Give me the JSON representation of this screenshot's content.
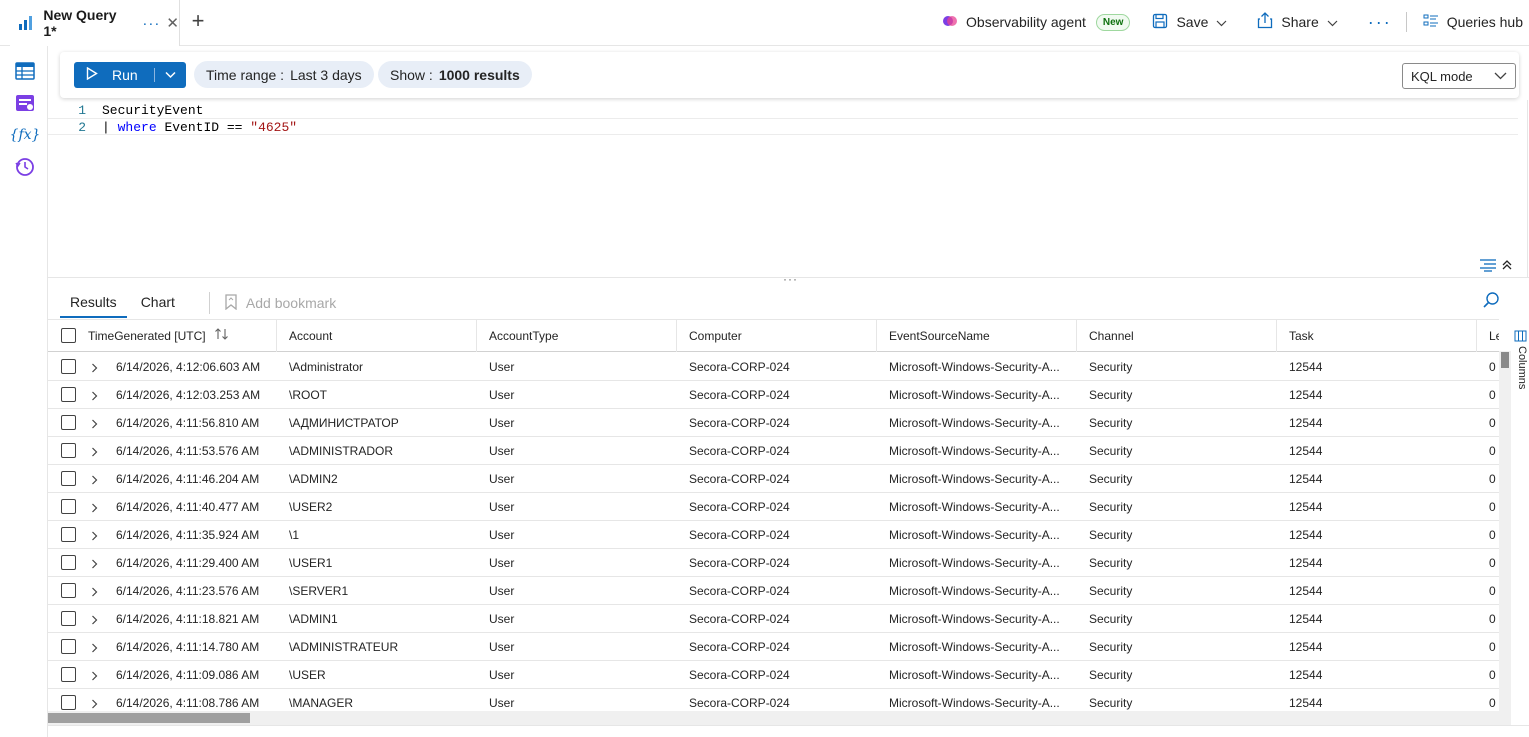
{
  "tab": {
    "title": "New Query 1*",
    "more": "···",
    "close": "✕",
    "new": "+"
  },
  "actions": {
    "agent_label": "Observability agent",
    "agent_badge": "New",
    "save_label": "Save",
    "share_label": "Share",
    "more": "···",
    "hub_label": "Queries hub"
  },
  "toolbar": {
    "run_label": "Run",
    "time_range_label": "Time range :",
    "time_range_value": "Last 3 days",
    "show_label": "Show :",
    "show_value": "1000 results",
    "mode_label": "KQL mode"
  },
  "editor": {
    "lines": [
      {
        "num": "1",
        "text": "SecurityEvent"
      },
      {
        "num": "2",
        "pipe": "|",
        "kw": "where",
        "mid": " EventID == ",
        "str": "\"4625\""
      }
    ]
  },
  "results": {
    "tabs": [
      "Results",
      "Chart"
    ],
    "bookmark_label": "Add bookmark",
    "columns_label": "Columns",
    "columns": [
      "TimeGenerated [UTC]",
      "Account",
      "AccountType",
      "Computer",
      "EventSourceName",
      "Channel",
      "Task",
      "Leve"
    ],
    "rows": [
      [
        "6/14/2026, 4:12:06.603 AM",
        "\\Administrator",
        "User",
        "Secora-CORP-024",
        "Microsoft-Windows-Security-A...",
        "Security",
        "12544",
        "0"
      ],
      [
        "6/14/2026, 4:12:03.253 AM",
        "\\ROOT",
        "User",
        "Secora-CORP-024",
        "Microsoft-Windows-Security-A...",
        "Security",
        "12544",
        "0"
      ],
      [
        "6/14/2026, 4:11:56.810 AM",
        "\\АДМИНИСТРАТОР",
        "User",
        "Secora-CORP-024",
        "Microsoft-Windows-Security-A...",
        "Security",
        "12544",
        "0"
      ],
      [
        "6/14/2026, 4:11:53.576 AM",
        "\\ADMINISTRADOR",
        "User",
        "Secora-CORP-024",
        "Microsoft-Windows-Security-A...",
        "Security",
        "12544",
        "0"
      ],
      [
        "6/14/2026, 4:11:46.204 AM",
        "\\ADMIN2",
        "User",
        "Secora-CORP-024",
        "Microsoft-Windows-Security-A...",
        "Security",
        "12544",
        "0"
      ],
      [
        "6/14/2026, 4:11:40.477 AM",
        "\\USER2",
        "User",
        "Secora-CORP-024",
        "Microsoft-Windows-Security-A...",
        "Security",
        "12544",
        "0"
      ],
      [
        "6/14/2026, 4:11:35.924 AM",
        "\\1",
        "User",
        "Secora-CORP-024",
        "Microsoft-Windows-Security-A...",
        "Security",
        "12544",
        "0"
      ],
      [
        "6/14/2026, 4:11:29.400 AM",
        "\\USER1",
        "User",
        "Secora-CORP-024",
        "Microsoft-Windows-Security-A...",
        "Security",
        "12544",
        "0"
      ],
      [
        "6/14/2026, 4:11:23.576 AM",
        "\\SERVER1",
        "User",
        "Secora-CORP-024",
        "Microsoft-Windows-Security-A...",
        "Security",
        "12544",
        "0"
      ],
      [
        "6/14/2026, 4:11:18.821 AM",
        "\\ADMIN1",
        "User",
        "Secora-CORP-024",
        "Microsoft-Windows-Security-A...",
        "Security",
        "12544",
        "0"
      ],
      [
        "6/14/2026, 4:11:14.780 AM",
        "\\ADMINISTRATEUR",
        "User",
        "Secora-CORP-024",
        "Microsoft-Windows-Security-A...",
        "Security",
        "12544",
        "0"
      ],
      [
        "6/14/2026, 4:11:09.086 AM",
        "\\USER",
        "User",
        "Secora-CORP-024",
        "Microsoft-Windows-Security-A...",
        "Security",
        "12544",
        "0"
      ],
      [
        "6/14/2026, 4:11:08.786 AM",
        "\\MANAGER",
        "User",
        "Secora-CORP-024",
        "Microsoft-Windows-Security-A...",
        "Security",
        "12544",
        "0"
      ]
    ]
  },
  "colors": {
    "accent": "#0f6cbd",
    "pill_bg": "#e8eef7",
    "badge_green": "#0e700e"
  },
  "icons": [
    "query-tab-icon",
    "agent-icon",
    "save-icon",
    "share-icon",
    "queries-hub-icon",
    "tables-icon",
    "queries-icon",
    "functions-icon",
    "history-icon",
    "play-icon",
    "bookmark-icon",
    "search-icon",
    "format-icon",
    "collapse-icon",
    "columns-icon"
  ]
}
